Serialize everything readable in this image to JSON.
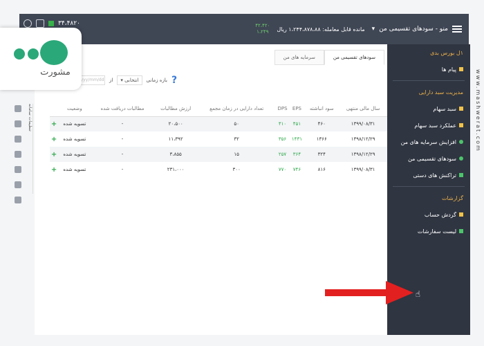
{
  "header": {
    "title": "منو - سودهای تقسیمی من",
    "balance_label": "مانده قابل معامله: ۱،۲۴۴،۸۷۸،۸۸ ریال",
    "green_top": "۴۲،۴۲۰",
    "green_bottom": "۱،۲۴۹",
    "stock_value": "۳۴،۴۸۲۰"
  },
  "sidebar": {
    "items": [
      {
        "label": "۱ل بورس بدی",
        "type": "section"
      },
      {
        "label": "پیام ها",
        "icon": "square-icon"
      },
      {
        "label": "مدیریت سبد دارایی",
        "type": "section"
      },
      {
        "label": "سبد سهام",
        "icon": "square-icon"
      },
      {
        "label": "عملکرد سبد سهام",
        "icon": "square-icon"
      },
      {
        "label": "افزایش سرمایه های من",
        "icon": "circle-icon"
      },
      {
        "label": "سودهای تقسیمی من",
        "icon": "circle-icon"
      },
      {
        "label": "تراکنش های دستی",
        "icon": "square-icon"
      },
      {
        "label": "گزارشات",
        "type": "section"
      },
      {
        "label": "گردش حساب",
        "icon": "square-icon"
      },
      {
        "label": "لیست سفارشات",
        "icon": "square-icon"
      }
    ]
  },
  "tabs": [
    {
      "label": "سودهای تقسیمی من"
    },
    {
      "label": "سرمایه های من"
    }
  ],
  "filter": {
    "period_label": "بازه زمانی",
    "period_value": "انتخابی",
    "input_placeholder": "yyyy/mm/dd"
  },
  "table": {
    "headers": [
      "سال مالی منتهی",
      "سود انباشته",
      "EPS",
      "DPS",
      "تعداد دارایی در زمان مجمع",
      "ارزش مطالبات",
      "مطالبات دریافت شده",
      "وضعیت",
      ""
    ],
    "rows": [
      [
        "۱۳۹۹/۰۸/۳۱",
        "۴۶۰",
        "۴۵۱",
        "۴۱۰",
        "۵۰",
        "۲۰،۵۰۰",
        "-",
        "تسویه شده",
        "+"
      ],
      [
        "۱۳۹۸/۱۲/۲۹",
        "۱۳۶۶",
        "۱۴۳۱",
        "۳۵۶",
        "۳۲",
        "۱۱،۳۹۲",
        "-",
        "تسویه شده",
        "+"
      ],
      [
        "۱۳۹۸/۱۲/۲۹",
        "۳۲۴",
        "۳۶۴",
        "۲۵۷",
        "۱۵",
        "۳،۸۵۵",
        "-",
        "تسویه شده",
        "+"
      ],
      [
        "۱۳۹۹/۰۸/۳۱",
        "۸۱۶",
        "۷۴۶",
        "۷۷۰",
        "۳۰۰",
        "۲۳۱،۰۰۰",
        "-",
        "تسویه شده",
        "+"
      ]
    ]
  },
  "side_tab": {
    "label": "تنظیمات سامانه"
  },
  "logo": {
    "text": "مشورت"
  },
  "watermark": "www.mashwerat.com",
  "colors": {
    "sidebar_bg": "#2f3541",
    "accent": "#f1c24a",
    "green": "#2da74a",
    "arrow": "#e32020"
  }
}
